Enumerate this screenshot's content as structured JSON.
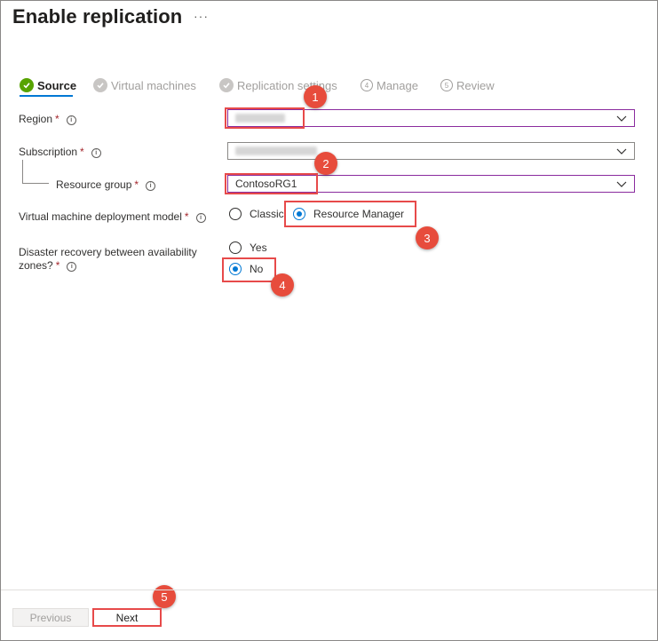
{
  "page": {
    "title": "Enable replication",
    "more_label": "···"
  },
  "steps": [
    {
      "label": "Source",
      "state": "active",
      "icon": "check-circle-green"
    },
    {
      "label": "Virtual machines",
      "state": "done",
      "icon": "check-circle-grey"
    },
    {
      "label": "Replication settings",
      "state": "done",
      "icon": "check-circle-grey"
    },
    {
      "label": "Manage",
      "state": "todo",
      "number": "4"
    },
    {
      "label": "Review",
      "state": "todo",
      "number": "5"
    }
  ],
  "form": {
    "region": {
      "label": "Region",
      "required": "*"
    },
    "subscription": {
      "label": "Subscription",
      "required": "*"
    },
    "resource_group": {
      "label": "Resource group",
      "required": "*",
      "value": "ContosoRG1"
    },
    "deployment_model": {
      "label": "Virtual machine deployment model",
      "required": "*",
      "options": [
        "Classic",
        "Resource Manager"
      ],
      "selected": "Resource Manager"
    },
    "disaster_recovery": {
      "label_line1": "Disaster recovery between availability",
      "label_line2": "zones?",
      "required": "*",
      "options": [
        "Yes",
        "No"
      ],
      "selected": "No"
    }
  },
  "annotations": [
    "1",
    "2",
    "3",
    "4",
    "5"
  ],
  "footer": {
    "previous_label": "Previous",
    "next_label": "Next"
  },
  "colors": {
    "accent": "#0078d4",
    "highlight": "#e74a4a",
    "success": "#57a300",
    "required": "#a4262c"
  }
}
